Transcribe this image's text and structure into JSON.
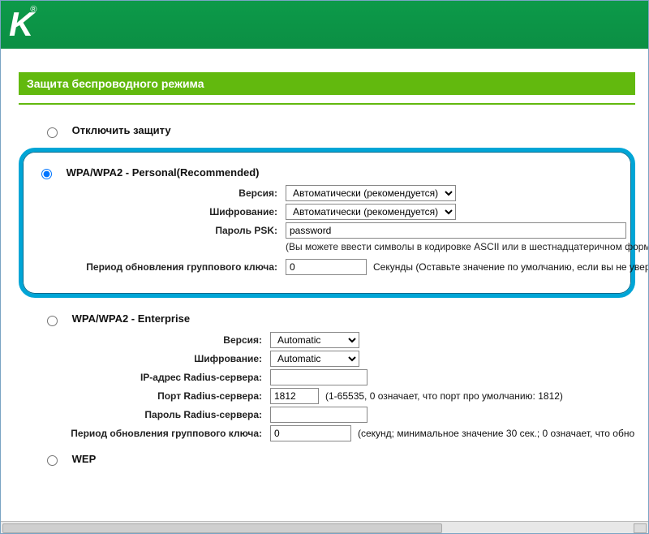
{
  "brand_fragment": "K",
  "brand_reg": "®",
  "section_title": "Защита беспроводного режима",
  "opts": {
    "disable": "Отключить защиту",
    "wpa_personal": "WPA/WPA2 - Personal(Recommended)",
    "wpa_enterprise": "WPA/WPA2 - Enterprise",
    "wep": "WEP"
  },
  "personal": {
    "version_label": "Версия:",
    "version_value": "Автоматически (рекомендуется)",
    "enc_label": "Шифрование:",
    "enc_value": "Автоматически (рекомендуется)",
    "psk_label": "Пароль PSK:",
    "psk_value": "password",
    "psk_hint": "(Вы можете ввести символы в кодировке ASCII или в шестнадцатеричном форм",
    "gk_label": "Период обновления группового ключа:",
    "gk_value": "0",
    "gk_hint": "Секунды (Оставьте значение по умолчанию, если вы не увер"
  },
  "enterprise": {
    "version_label": "Версия:",
    "version_value": "Automatic",
    "enc_label": "Шифрование:",
    "enc_value": "Automatic",
    "ip_label": "IP-адрес Radius-сервера:",
    "ip_value": "",
    "port_label": "Порт Radius-сервера:",
    "port_value": "1812",
    "port_hint": "(1-65535, 0 означает, что порт про умолчанию: 1812)",
    "pwd_label": "Пароль Radius-сервера:",
    "pwd_value": "",
    "gk_label": "Период обновления группового ключа:",
    "gk_value": "0",
    "gk_hint": "(секунд; минимальное значение 30 сек.; 0 означает, что обно"
  }
}
